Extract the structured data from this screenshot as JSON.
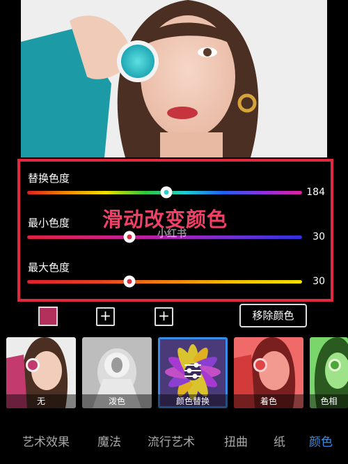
{
  "colors": {
    "accent_red": "#e0283f",
    "caption_pink": "#f04065",
    "selected_blue": "#3a8de6",
    "swatch": "#b3305c"
  },
  "sliders": [
    {
      "label": "替换色度",
      "value": "184",
      "position": 0.53,
      "dot": "#2ad0d0"
    },
    {
      "label": "最小色度",
      "value": "30",
      "position": 0.37,
      "dot": "#e0283f"
    },
    {
      "label": "最大色度",
      "value": "30",
      "position": 0.37,
      "dot": "#e0283f"
    }
  ],
  "overlay": {
    "caption": "滑动改变颜色",
    "watermark": "小红书"
  },
  "controls": {
    "plus_1": "+",
    "plus_2": "+",
    "remove_label": "移除颜色"
  },
  "filters": [
    {
      "label": "无"
    },
    {
      "label": "泼色"
    },
    {
      "label": "颜色替换"
    },
    {
      "label": "着色"
    },
    {
      "label": "色相"
    }
  ],
  "tabs": [
    {
      "label": "艺术效果"
    },
    {
      "label": "魔法"
    },
    {
      "label": "流行艺术"
    },
    {
      "label": "扭曲"
    },
    {
      "label": "纸"
    },
    {
      "label": "颜色"
    }
  ]
}
